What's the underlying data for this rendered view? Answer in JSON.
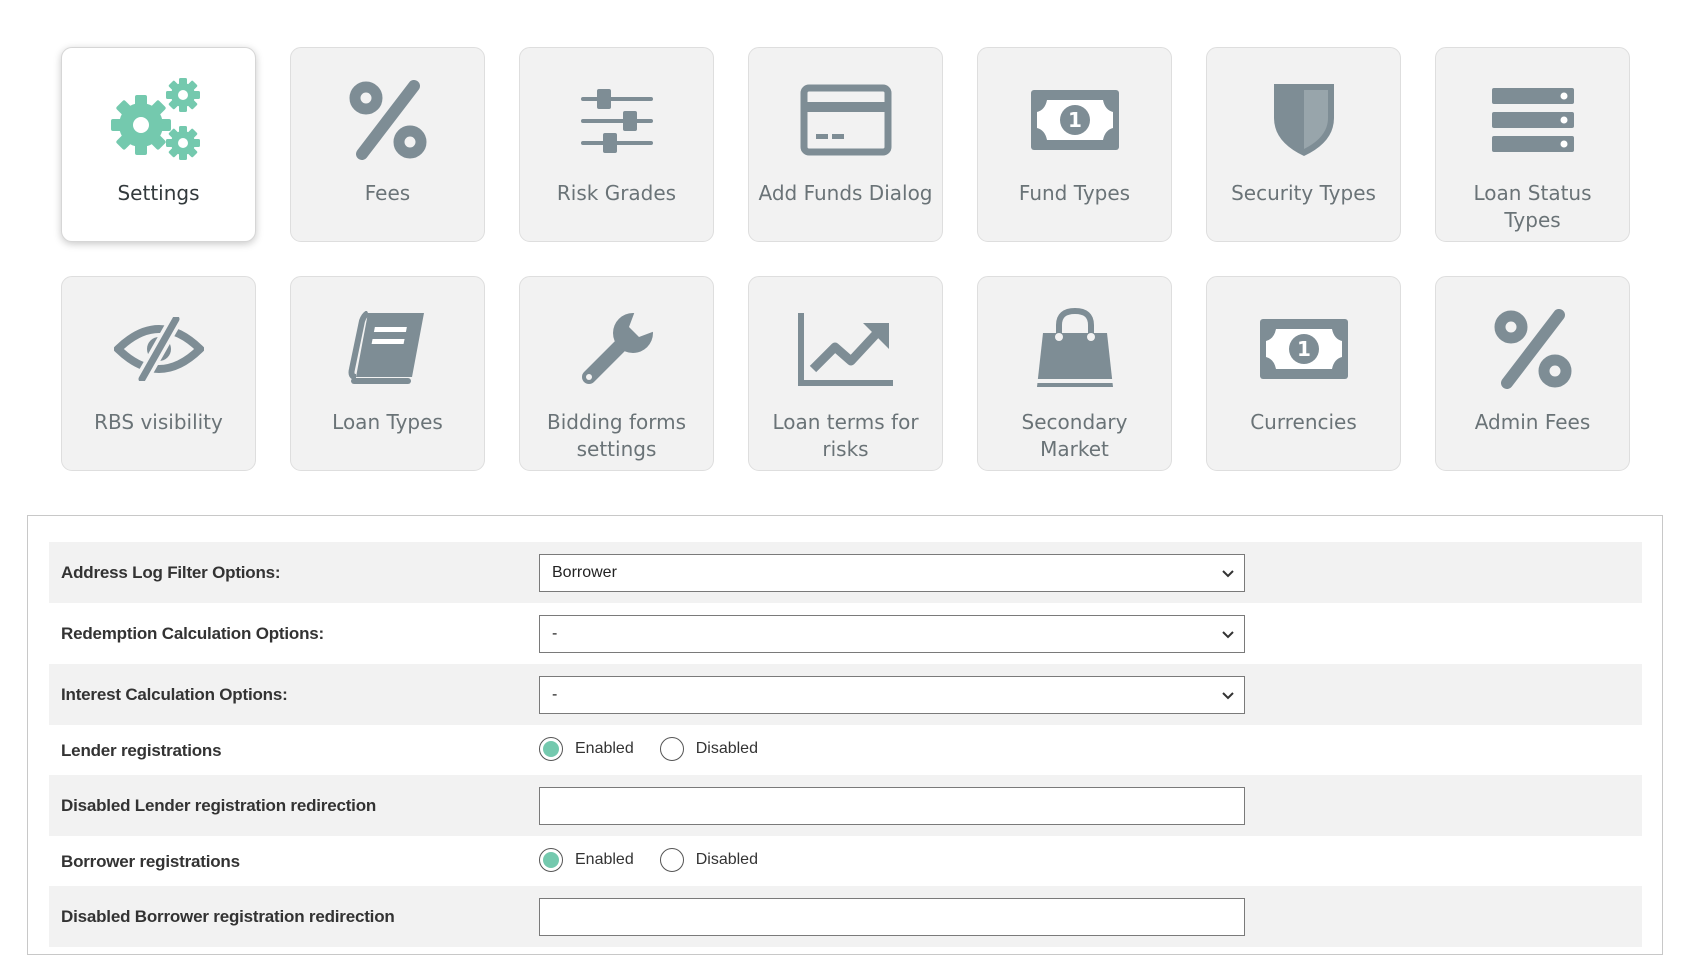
{
  "colors": {
    "accent": "#74c9ae",
    "icon_gray": "#7e8d95",
    "tile_bg": "#f2f2f2",
    "row_alt_bg": "#f2f2f2"
  },
  "tiles": [
    {
      "label": "Settings",
      "icon": "gears-icon",
      "active": true
    },
    {
      "label": "Fees",
      "icon": "percent-icon"
    },
    {
      "label": "Risk Grades",
      "icon": "sliders-icon"
    },
    {
      "label": "Add Funds Dialog",
      "icon": "credit-card-icon"
    },
    {
      "label": "Fund Types",
      "icon": "banknote-icon"
    },
    {
      "label": "Security Types",
      "icon": "shield-icon"
    },
    {
      "label": "Loan Status Types",
      "icon": "server-icon"
    },
    {
      "label": "RBS visibility",
      "icon": "eye-slash-icon"
    },
    {
      "label": "Loan Types",
      "icon": "book-icon"
    },
    {
      "label": "Bidding forms settings",
      "icon": "wrench-icon"
    },
    {
      "label": "Loan terms for risks",
      "icon": "line-chart-icon"
    },
    {
      "label": "Secondary Market",
      "icon": "shopping-bag-icon"
    },
    {
      "label": "Currencies",
      "icon": "banknote-icon"
    },
    {
      "label": "Admin Fees",
      "icon": "percent-icon"
    }
  ],
  "form": {
    "address_log": {
      "label": "Address Log Filter Options:",
      "value": "Borrower"
    },
    "redemption": {
      "label": "Redemption Calculation Options:",
      "value": "-"
    },
    "interest": {
      "label": "Interest Calculation Options:",
      "value": "-"
    },
    "lender_reg": {
      "label": "Lender registrations",
      "selected": "Enabled",
      "options": [
        "Enabled",
        "Disabled"
      ]
    },
    "lender_redirect": {
      "label": "Disabled Lender registration redirection",
      "value": ""
    },
    "borrower_reg": {
      "label": "Borrower registrations",
      "selected": "Enabled",
      "options": [
        "Enabled",
        "Disabled"
      ]
    },
    "borrower_redirect": {
      "label": "Disabled Borrower registration redirection",
      "value": ""
    }
  }
}
